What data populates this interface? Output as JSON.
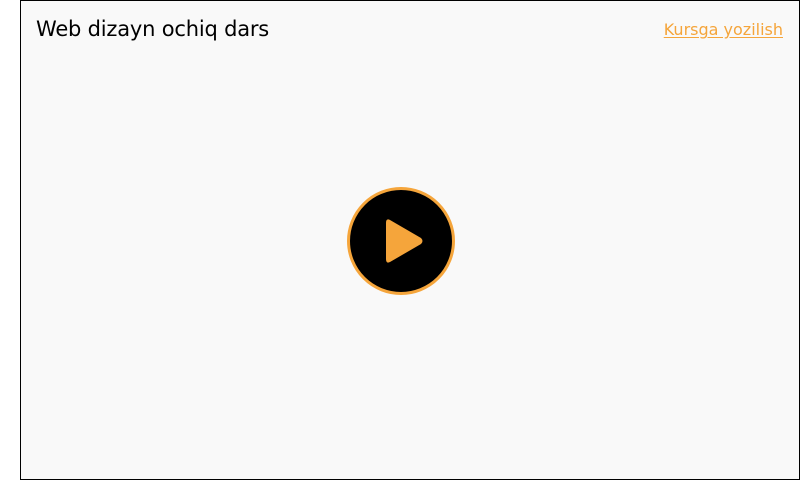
{
  "lesson": {
    "title": "Web dizayn ochiq dars",
    "enroll_label": "Kursga yozilish"
  },
  "player": {
    "play_icon": "play-icon"
  },
  "colors": {
    "accent": "#f5a53b",
    "card_background": "#f9f9f9",
    "play_fill": "#000000",
    "border": "#000000"
  }
}
